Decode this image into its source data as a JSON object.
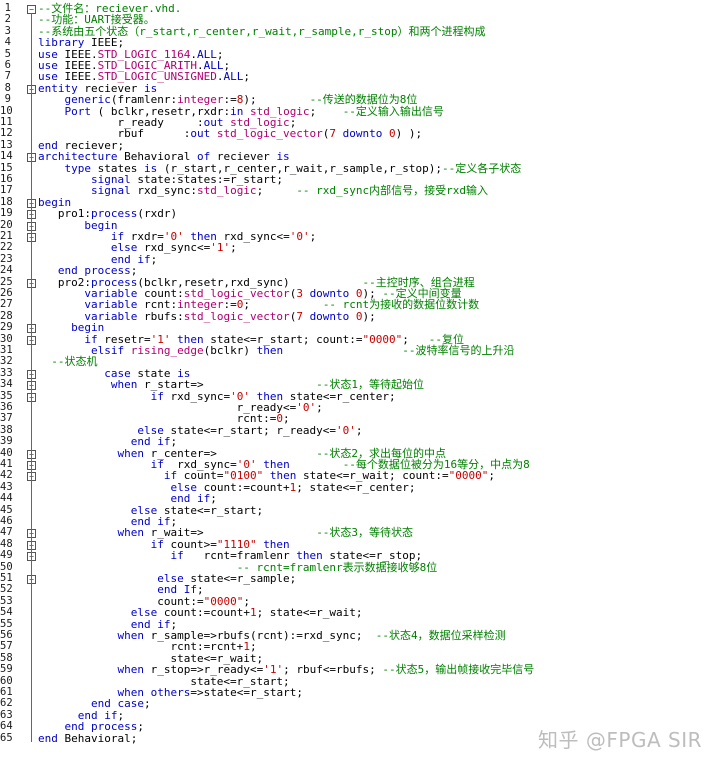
{
  "editor": {
    "lines": [
      [
        [
          "c",
          "--文件名：reciever.vhd."
        ]
      ],
      [
        [
          "c",
          "--功能：UART接受器。"
        ]
      ],
      [
        [
          "c",
          "--系统由五个状态（r_start,r_center,r_wait,r_sample,r_stop）和两个进程构成"
        ]
      ],
      [
        [
          "k",
          "library "
        ],
        [
          "i",
          "IEEE;"
        ]
      ],
      [
        [
          "k",
          "use "
        ],
        [
          "i",
          "IEEE."
        ],
        [
          "t",
          "STD_LOGIC_1164"
        ],
        [
          "i",
          "."
        ],
        [
          "k",
          "ALL"
        ],
        [
          "i",
          ";"
        ]
      ],
      [
        [
          "k",
          "use "
        ],
        [
          "i",
          "IEEE."
        ],
        [
          "t",
          "STD_LOGIC_ARITH"
        ],
        [
          "i",
          "."
        ],
        [
          "k",
          "ALL"
        ],
        [
          "i",
          ";"
        ]
      ],
      [
        [
          "k",
          "use "
        ],
        [
          "i",
          "IEEE."
        ],
        [
          "t",
          "STD_LOGIC_UNSIGNED"
        ],
        [
          "i",
          "."
        ],
        [
          "k",
          "ALL"
        ],
        [
          "i",
          ";"
        ]
      ],
      [
        [
          "k",
          "entity "
        ],
        [
          "i",
          "reciever "
        ],
        [
          "k",
          "is"
        ]
      ],
      [
        [
          "i",
          "    "
        ],
        [
          "k",
          "generic"
        ],
        [
          "i",
          "(framlenr:"
        ],
        [
          "t",
          "integer"
        ],
        [
          "i",
          ":="
        ],
        [
          "n",
          "8"
        ],
        [
          "i",
          ");        "
        ],
        [
          "c",
          "--传送的数据位为8位"
        ]
      ],
      [
        [
          "i",
          "    "
        ],
        [
          "k",
          "Port "
        ],
        [
          "i",
          "( bclkr,resetr,rxdr:"
        ],
        [
          "k",
          "in "
        ],
        [
          "t",
          "std_logic"
        ],
        [
          "i",
          ";    "
        ],
        [
          "c",
          "--定义输入输出信号"
        ]
      ],
      [
        [
          "i",
          "            r_ready     :"
        ],
        [
          "k",
          "out "
        ],
        [
          "t",
          "std_logic"
        ],
        [
          "i",
          ";"
        ]
      ],
      [
        [
          "i",
          "            rbuf      :"
        ],
        [
          "k",
          "out "
        ],
        [
          "t",
          "std_logic_vector"
        ],
        [
          "i",
          "("
        ],
        [
          "n",
          "7"
        ],
        [
          "i",
          " "
        ],
        [
          "k",
          "downto "
        ],
        [
          "n",
          "0"
        ],
        [
          "i",
          ") );"
        ]
      ],
      [
        [
          "k",
          "end "
        ],
        [
          "i",
          "reciever;"
        ]
      ],
      [
        [
          "k",
          "architecture "
        ],
        [
          "i",
          "Behavioral "
        ],
        [
          "k",
          "of "
        ],
        [
          "i",
          "reciever "
        ],
        [
          "k",
          "is"
        ]
      ],
      [
        [
          "i",
          "    "
        ],
        [
          "k",
          "type "
        ],
        [
          "i",
          "states "
        ],
        [
          "k",
          "is "
        ],
        [
          "i",
          "(r_start,r_center,r_wait,r_sample,r_stop);"
        ],
        [
          "c",
          "--定义各子状态"
        ]
      ],
      [
        [
          "i",
          "        "
        ],
        [
          "k",
          "signal "
        ],
        [
          "i",
          "state:states:=r_start;"
        ]
      ],
      [
        [
          "i",
          "        "
        ],
        [
          "k",
          "signal "
        ],
        [
          "i",
          "rxd_sync:"
        ],
        [
          "t",
          "std_logic"
        ],
        [
          "i",
          ";     "
        ],
        [
          "c",
          "-- rxd_sync内部信号，接受rxd输入"
        ]
      ],
      [
        [
          "k",
          "begin"
        ]
      ],
      [
        [
          "i",
          "   pro1:"
        ],
        [
          "k",
          "process"
        ],
        [
          "i",
          "(rxdr)"
        ]
      ],
      [
        [
          "i",
          "       "
        ],
        [
          "k",
          "begin"
        ]
      ],
      [
        [
          "i",
          "           "
        ],
        [
          "k",
          "if "
        ],
        [
          "i",
          "rxdr="
        ],
        [
          "s",
          "'0' "
        ],
        [
          "k",
          "then "
        ],
        [
          "i",
          "rxd_sync<="
        ],
        [
          "s",
          "'0'"
        ],
        [
          "i",
          ";"
        ]
      ],
      [
        [
          "i",
          "           "
        ],
        [
          "k",
          "else "
        ],
        [
          "i",
          "rxd_sync<="
        ],
        [
          "s",
          "'1'"
        ],
        [
          "i",
          ";"
        ]
      ],
      [
        [
          "i",
          "           "
        ],
        [
          "k",
          "end if"
        ],
        [
          "i",
          ";"
        ]
      ],
      [
        [
          "i",
          "   "
        ],
        [
          "k",
          "end process"
        ],
        [
          "i",
          ";"
        ]
      ],
      [
        [
          "i",
          "   pro2:"
        ],
        [
          "k",
          "process"
        ],
        [
          "i",
          "(bclkr,resetr,rxd_sync)           "
        ],
        [
          "c",
          "--主控时序、组合进程"
        ]
      ],
      [
        [
          "i",
          "       "
        ],
        [
          "k",
          "variable "
        ],
        [
          "i",
          "count:"
        ],
        [
          "t",
          "std_logic_vector"
        ],
        [
          "i",
          "("
        ],
        [
          "n",
          "3"
        ],
        [
          "i",
          " "
        ],
        [
          "k",
          "downto "
        ],
        [
          "n",
          "0"
        ],
        [
          "i",
          "); "
        ],
        [
          "c",
          "--定义中间变量"
        ]
      ],
      [
        [
          "i",
          "       "
        ],
        [
          "k",
          "variable "
        ],
        [
          "i",
          "rcnt:"
        ],
        [
          "t",
          "integer"
        ],
        [
          "i",
          ":="
        ],
        [
          "n",
          "0"
        ],
        [
          "i",
          ";           "
        ],
        [
          "c",
          "-- rcnt为接收的数据位数计数"
        ]
      ],
      [
        [
          "i",
          "       "
        ],
        [
          "k",
          "variable "
        ],
        [
          "i",
          "rbufs:"
        ],
        [
          "t",
          "std_logic_vector"
        ],
        [
          "i",
          "("
        ],
        [
          "n",
          "7"
        ],
        [
          "i",
          " "
        ],
        [
          "k",
          "downto "
        ],
        [
          "n",
          "0"
        ],
        [
          "i",
          ");"
        ]
      ],
      [
        [
          "i",
          "     "
        ],
        [
          "k",
          "begin"
        ]
      ],
      [
        [
          "i",
          "       "
        ],
        [
          "k",
          "if "
        ],
        [
          "i",
          "resetr="
        ],
        [
          "s",
          "'1' "
        ],
        [
          "k",
          "then "
        ],
        [
          "i",
          "state<=r_start; count:="
        ],
        [
          "s",
          "\"0000\""
        ],
        [
          "i",
          ";   "
        ],
        [
          "c",
          "--复位"
        ]
      ],
      [
        [
          "i",
          "        "
        ],
        [
          "k",
          "elsif "
        ],
        [
          "t",
          "rising_edge"
        ],
        [
          "i",
          "(bclkr) "
        ],
        [
          "k",
          "then"
        ],
        [
          "i",
          "                  "
        ],
        [
          "c",
          "--波特率信号的上升沿"
        ]
      ],
      [
        [
          "c",
          "  --状态机"
        ]
      ],
      [
        [
          "i",
          "          "
        ],
        [
          "k",
          "case "
        ],
        [
          "i",
          "state "
        ],
        [
          "k",
          "is"
        ]
      ],
      [
        [
          "i",
          "           "
        ],
        [
          "k",
          "when "
        ],
        [
          "i",
          "r_start=>                 "
        ],
        [
          "c",
          "--状态1，等待起始位"
        ]
      ],
      [
        [
          "i",
          "                 "
        ],
        [
          "k",
          "if "
        ],
        [
          "i",
          "rxd_sync="
        ],
        [
          "s",
          "'0' "
        ],
        [
          "k",
          "then "
        ],
        [
          "i",
          "state<=r_center;"
        ]
      ],
      [
        [
          "i",
          "                              r_ready<="
        ],
        [
          "s",
          "'0'"
        ],
        [
          "i",
          ";"
        ]
      ],
      [
        [
          "i",
          "                              rcnt:="
        ],
        [
          "n",
          "0"
        ],
        [
          "i",
          ";"
        ]
      ],
      [
        [
          "i",
          "               "
        ],
        [
          "k",
          "else "
        ],
        [
          "i",
          "state<=r_start; r_ready<="
        ],
        [
          "s",
          "'0'"
        ],
        [
          "i",
          ";"
        ]
      ],
      [
        [
          "i",
          "              "
        ],
        [
          "k",
          "end if"
        ],
        [
          "i",
          ";"
        ]
      ],
      [
        [
          "i",
          "            "
        ],
        [
          "k",
          "when "
        ],
        [
          "i",
          "r_center=>               "
        ],
        [
          "c",
          "--状态2，求出每位的中点"
        ]
      ],
      [
        [
          "i",
          "                 "
        ],
        [
          "k",
          "if  "
        ],
        [
          "i",
          "rxd_sync="
        ],
        [
          "s",
          "'0' "
        ],
        [
          "k",
          "then"
        ],
        [
          "i",
          "        "
        ],
        [
          "c",
          "--每个数据位被分为16等分，中点为8"
        ]
      ],
      [
        [
          "i",
          "                   "
        ],
        [
          "k",
          "if "
        ],
        [
          "i",
          "count="
        ],
        [
          "s",
          "\"0100\" "
        ],
        [
          "k",
          "then "
        ],
        [
          "i",
          "state<=r_wait; count:="
        ],
        [
          "s",
          "\"0000\""
        ],
        [
          "i",
          ";"
        ]
      ],
      [
        [
          "i",
          "                    "
        ],
        [
          "k",
          "else "
        ],
        [
          "i",
          "count:=count+"
        ],
        [
          "n",
          "1"
        ],
        [
          "i",
          "; state<=r_center;"
        ]
      ],
      [
        [
          "i",
          "                    "
        ],
        [
          "k",
          "end if"
        ],
        [
          "i",
          ";"
        ]
      ],
      [
        [
          "i",
          "              "
        ],
        [
          "k",
          "else "
        ],
        [
          "i",
          "state<=r_start;"
        ]
      ],
      [
        [
          "i",
          "              "
        ],
        [
          "k",
          "end if"
        ],
        [
          "i",
          ";"
        ]
      ],
      [
        [
          "i",
          "            "
        ],
        [
          "k",
          "when "
        ],
        [
          "i",
          "r_wait=>                 "
        ],
        [
          "c",
          "--状态3，等待状态"
        ]
      ],
      [
        [
          "i",
          "                 "
        ],
        [
          "k",
          "if "
        ],
        [
          "i",
          "count>="
        ],
        [
          "s",
          "\"1110\" "
        ],
        [
          "k",
          "then"
        ]
      ],
      [
        [
          "i",
          "                    "
        ],
        [
          "k",
          "if   "
        ],
        [
          "i",
          "rcnt=framlenr "
        ],
        [
          "k",
          "then "
        ],
        [
          "i",
          "state<=r_stop;"
        ]
      ],
      [
        [
          "i",
          "                              "
        ],
        [
          "c",
          "-- rcnt=framlenr表示数据接收够8位"
        ]
      ],
      [
        [
          "i",
          "                  "
        ],
        [
          "k",
          "else "
        ],
        [
          "i",
          "state<=r_sample;"
        ]
      ],
      [
        [
          "i",
          "                  "
        ],
        [
          "k",
          "end If"
        ],
        [
          "i",
          ";"
        ]
      ],
      [
        [
          "i",
          "                  count:="
        ],
        [
          "s",
          "\"0000\""
        ],
        [
          "i",
          ";"
        ]
      ],
      [
        [
          "i",
          "              "
        ],
        [
          "k",
          "else "
        ],
        [
          "i",
          "count:=count+"
        ],
        [
          "n",
          "1"
        ],
        [
          "i",
          "; state<=r_wait;"
        ]
      ],
      [
        [
          "i",
          "              "
        ],
        [
          "k",
          "end if"
        ],
        [
          "i",
          ";"
        ]
      ],
      [
        [
          "i",
          "            "
        ],
        [
          "k",
          "when "
        ],
        [
          "i",
          "r_sample=>rbufs(rcnt):=rxd_sync;  "
        ],
        [
          "c",
          "--状态4，数据位采样检测"
        ]
      ],
      [
        [
          "i",
          "                    rcnt:=rcnt+"
        ],
        [
          "n",
          "1"
        ],
        [
          "i",
          ";"
        ]
      ],
      [
        [
          "i",
          "                    state<=r_wait;"
        ]
      ],
      [
        [
          "i",
          "            "
        ],
        [
          "k",
          "when "
        ],
        [
          "i",
          "r_stop=>r_ready<="
        ],
        [
          "s",
          "'1'"
        ],
        [
          "i",
          "; rbuf<=rbufs; "
        ],
        [
          "c",
          "--状态5，输出帧接收完毕信号"
        ]
      ],
      [
        [
          "i",
          "                       state<=r_start;"
        ]
      ],
      [
        [
          "i",
          "            "
        ],
        [
          "k",
          "when "
        ],
        [
          "k",
          "others"
        ],
        [
          "i",
          "=>state<=r_start;"
        ]
      ],
      [
        [
          "i",
          "        "
        ],
        [
          "k",
          "end case"
        ],
        [
          "i",
          ";"
        ]
      ],
      [
        [
          "i",
          "      "
        ],
        [
          "k",
          "end if"
        ],
        [
          "i",
          ";"
        ]
      ],
      [
        [
          "i",
          "    "
        ],
        [
          "k",
          "end process"
        ],
        [
          "i",
          ";"
        ]
      ],
      [
        [
          "k",
          "end "
        ],
        [
          "i",
          "Behavioral;"
        ]
      ]
    ],
    "fold_markers": [
      {
        "line": 1,
        "glyph": "−"
      },
      {
        "line": 8,
        "glyph": "−"
      },
      {
        "line": 14,
        "glyph": "−"
      },
      {
        "line": 18,
        "glyph": "−"
      },
      {
        "line": 19,
        "glyph": "−"
      },
      {
        "line": 20,
        "glyph": "−"
      },
      {
        "line": 21,
        "glyph": "−"
      },
      {
        "line": 25,
        "glyph": "−"
      },
      {
        "line": 29,
        "glyph": "−"
      },
      {
        "line": 30,
        "glyph": "−"
      },
      {
        "line": 33,
        "glyph": "−"
      },
      {
        "line": 34,
        "glyph": "−"
      },
      {
        "line": 35,
        "glyph": "−"
      },
      {
        "line": 40,
        "glyph": "−"
      },
      {
        "line": 41,
        "glyph": "−"
      },
      {
        "line": 42,
        "glyph": "−"
      },
      {
        "line": 47,
        "glyph": "−"
      },
      {
        "line": 48,
        "glyph": "−"
      },
      {
        "line": 49,
        "glyph": "−"
      },
      {
        "line": 51,
        "glyph": "−"
      }
    ]
  },
  "watermark": {
    "text": "知乎 @FPGA SIR"
  },
  "colors": {
    "keyword": "#0000c8",
    "comment": "#008000",
    "type": "#b0006e",
    "literal": "#c80000",
    "identifier": "#000000"
  }
}
